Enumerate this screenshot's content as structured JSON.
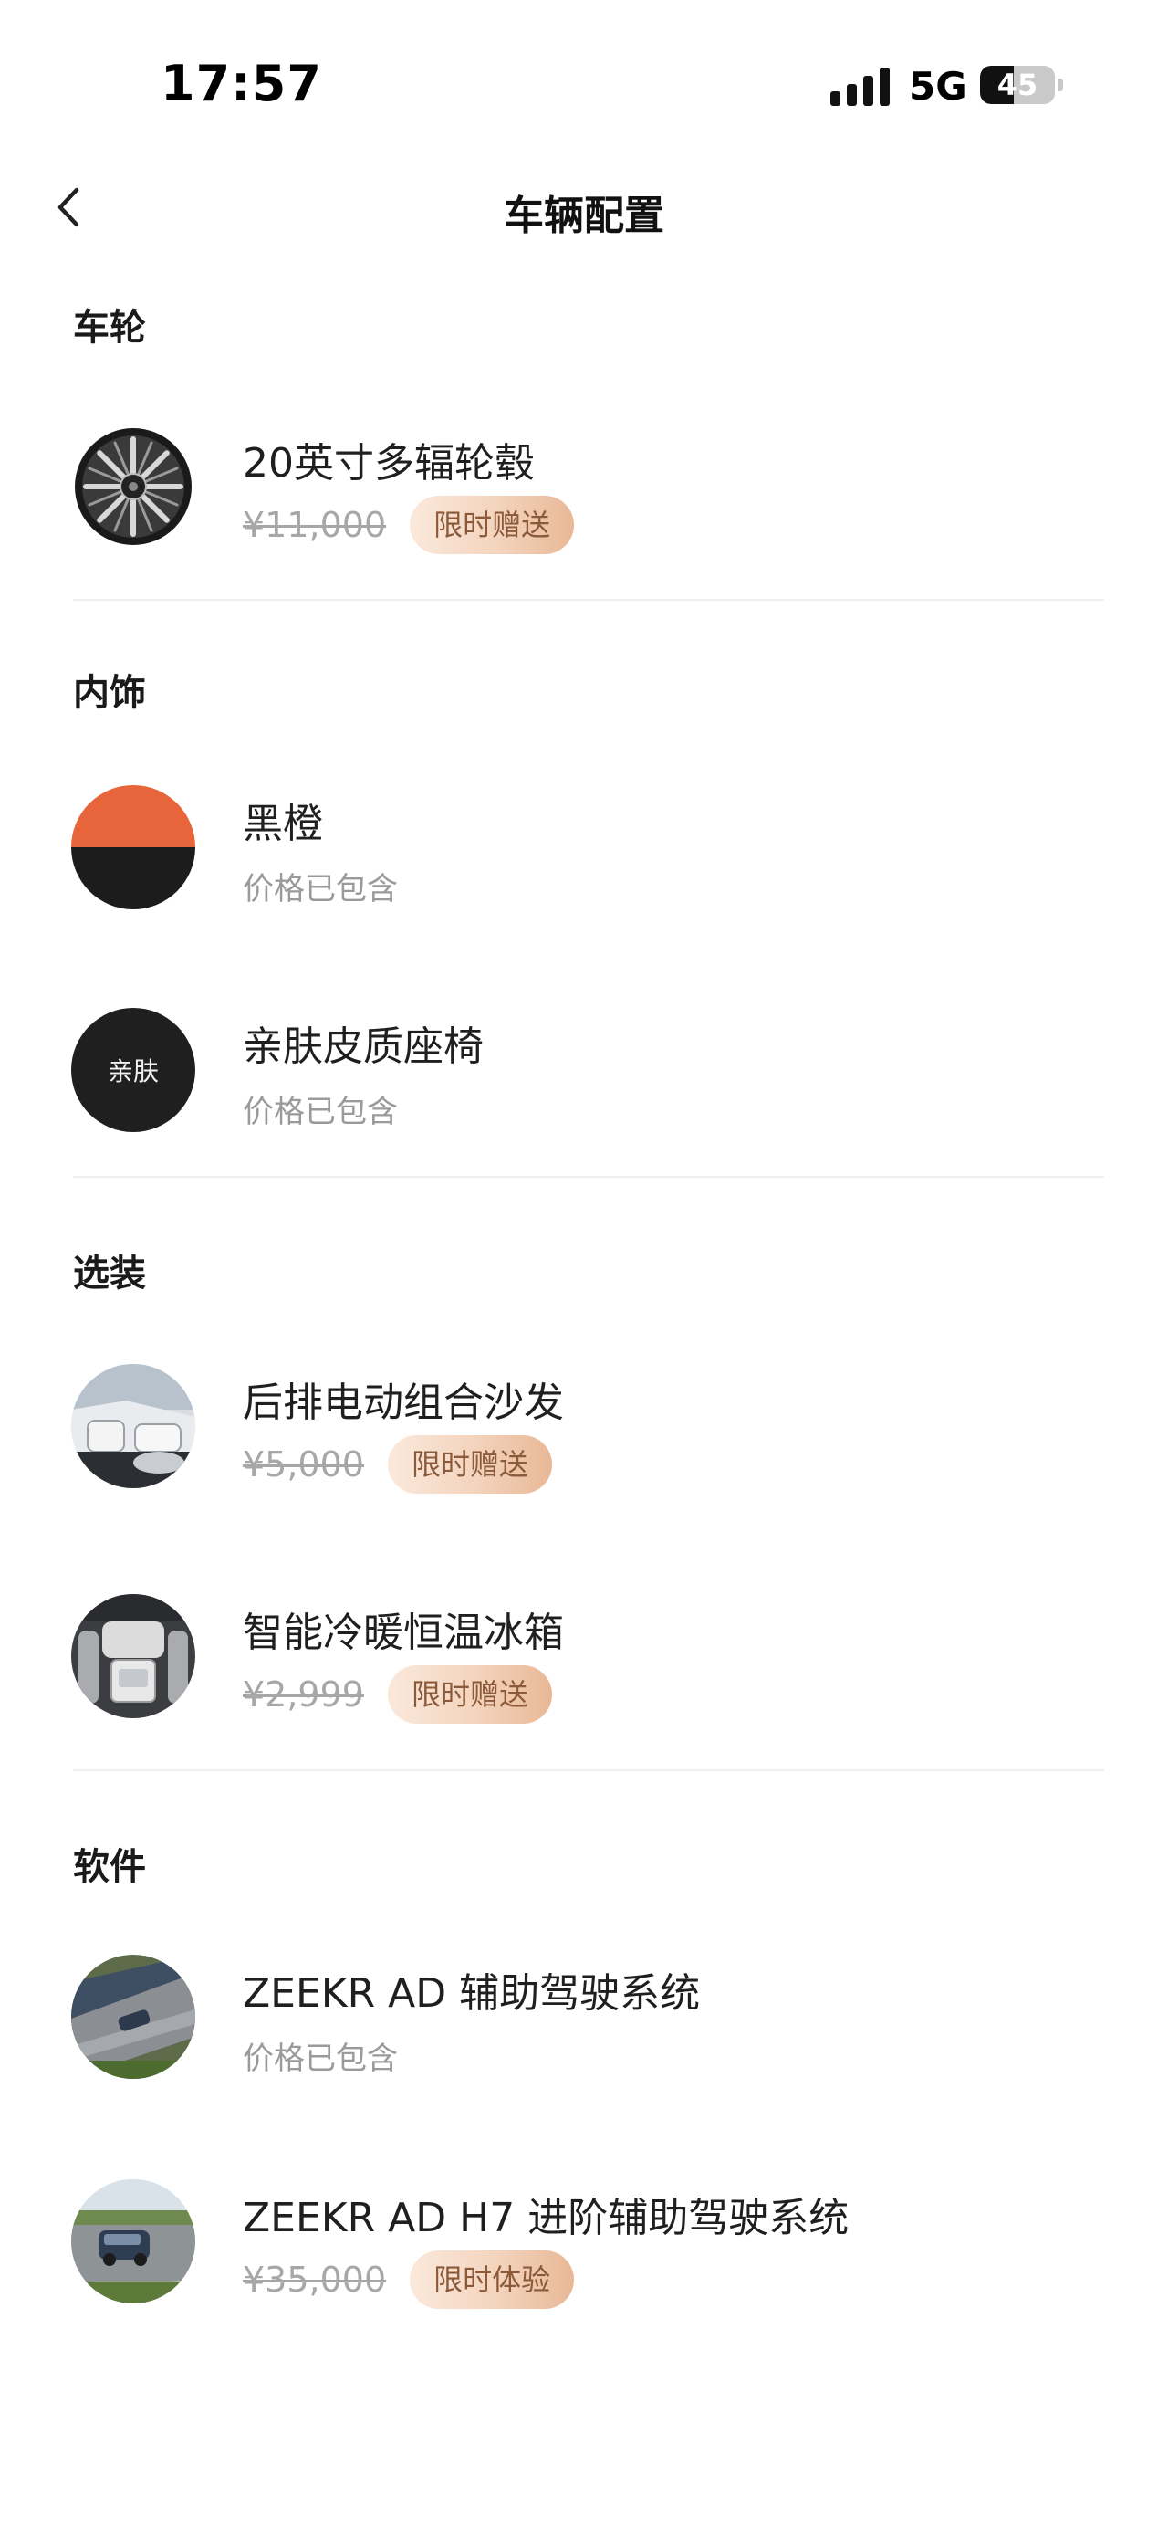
{
  "status_bar": {
    "time": "17:57",
    "network": "5G",
    "battery": "45",
    "battery_level": 0.45
  },
  "header": {
    "title": "车辆配置"
  },
  "sections": {
    "wheels": {
      "title": "车轮",
      "items": [
        {
          "name": "20英寸多辐轮毂",
          "price": "¥11,000",
          "badge": "限时赠送",
          "thumb": "wheel-rim-icon"
        }
      ]
    },
    "interior": {
      "title": "内饰",
      "items": [
        {
          "name": "黑橙",
          "included": "价格已包含",
          "thumb": "black-orange-swatch"
        },
        {
          "name": "亲肤皮质座椅",
          "included": "价格已包含",
          "thumb": "leather-swatch",
          "swatch_label": "亲肤"
        }
      ]
    },
    "options": {
      "title": "选装",
      "items": [
        {
          "name": "后排电动组合沙发",
          "price": "¥5,000",
          "badge": "限时赠送",
          "thumb": "rear-sofa-photo"
        },
        {
          "name": "智能冷暖恒温冰箱",
          "price": "¥2,999",
          "badge": "限时赠送",
          "thumb": "fridge-photo"
        }
      ]
    },
    "software": {
      "title": "软件",
      "items": [
        {
          "name": "ZEEKR AD 辅助驾驶系统",
          "included": "价格已包含",
          "thumb": "car-road-photo"
        },
        {
          "name": "ZEEKR AD H7 进阶辅助驾驶系统",
          "price": "¥35,000",
          "badge": "限时体验",
          "thumb": "car-highway-photo"
        }
      ]
    }
  },
  "colors": {
    "badge_text": "#8b5a3a",
    "badge_bg_start": "#fbe9dc",
    "badge_bg_end": "#e8b896",
    "swatch_orange": "#e8643a",
    "swatch_black": "#1c1c1c"
  }
}
